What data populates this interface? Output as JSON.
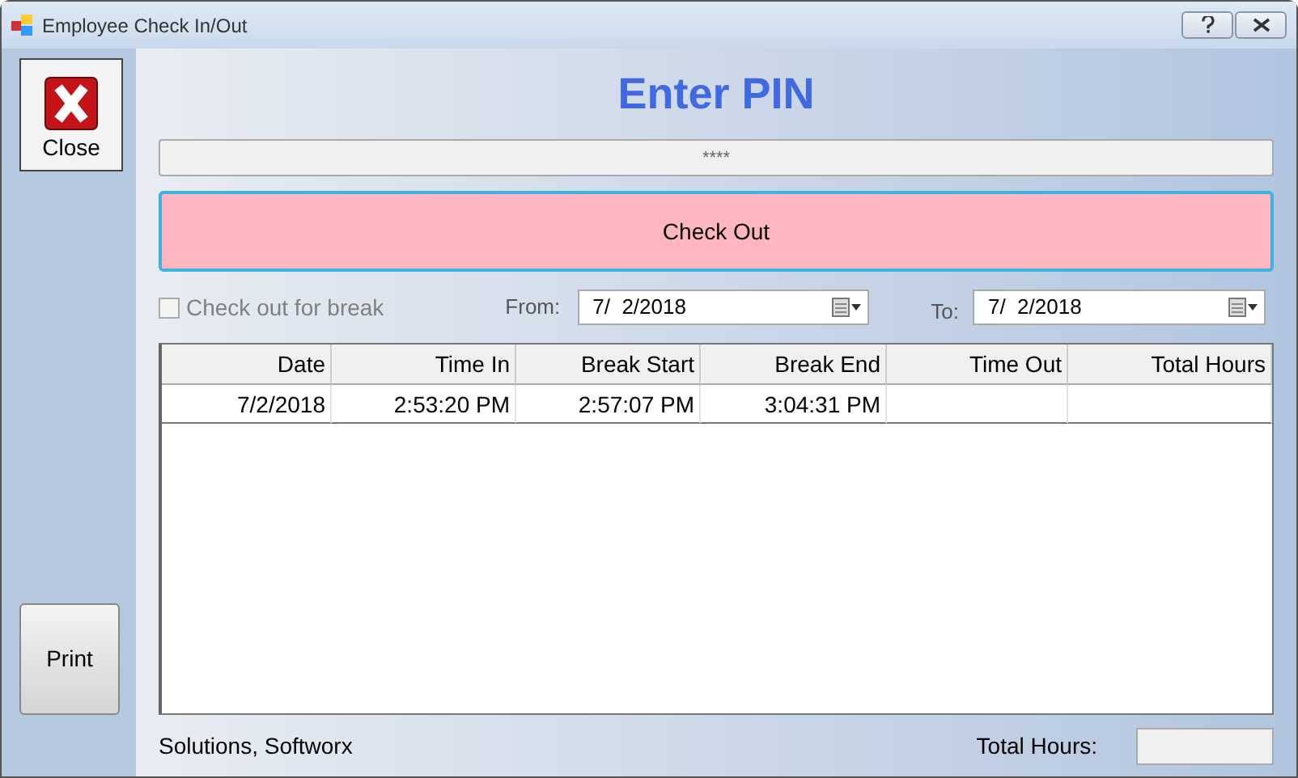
{
  "window": {
    "title": "Employee Check In/Out"
  },
  "sidebar": {
    "close_button": "Close",
    "print_button": "Print"
  },
  "heading": "Enter PIN",
  "pin_field": {
    "value": "****"
  },
  "action_button": "Check Out",
  "break_checkbox": {
    "label": "Check out for break",
    "checked": false,
    "disabled": true
  },
  "from": {
    "label": "From:",
    "value": "7/  2/2018"
  },
  "to": {
    "label": "To:",
    "value": "7/  2/2018"
  },
  "table": {
    "columns": [
      "Date",
      "Time In",
      "Break Start",
      "Break End",
      "Time Out",
      "Total Hours"
    ],
    "rows": [
      {
        "cells": [
          "7/2/2018",
          "2:53:20 PM",
          "2:57:07 PM",
          "3:04:31 PM"
        ]
      }
    ]
  },
  "footer": {
    "user": "Solutions, Softworx",
    "total_label": "Total Hours:"
  }
}
